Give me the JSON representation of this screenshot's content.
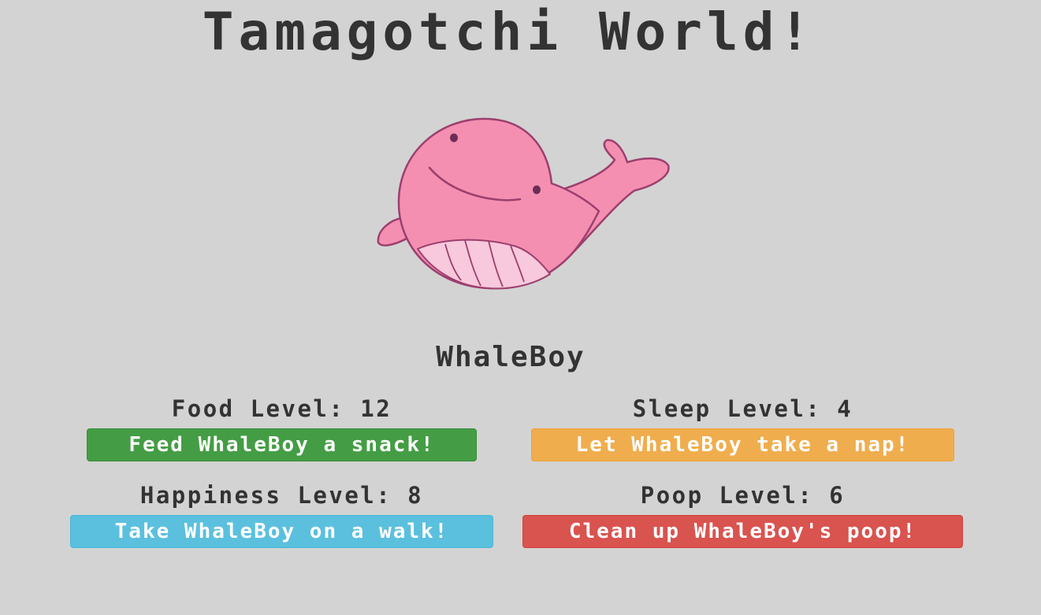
{
  "header": {
    "title": "Tamagotchi World!"
  },
  "pet": {
    "name": "WhaleBoy",
    "image": "pink-whale-image"
  },
  "stats": {
    "food": {
      "label": "Food Level: 12",
      "button": "Feed WhaleBoy a snack!",
      "color": "#449d44"
    },
    "sleep": {
      "label": "Sleep Level: 4",
      "button": "Let WhaleBoy take a nap!",
      "color": "#f0ad4e"
    },
    "happiness": {
      "label": "Happiness Level: 8",
      "button": "Take WhaleBoy on a walk!",
      "color": "#5bc0de"
    },
    "poop": {
      "label": "Poop Level: 6",
      "button": "Clean up WhaleBoy's poop!",
      "color": "#d9534f"
    }
  },
  "colors": {
    "background": "#d3d3d3",
    "text": "#333333",
    "whale_body": "#f48fb1",
    "whale_belly": "#f8c8dc"
  }
}
